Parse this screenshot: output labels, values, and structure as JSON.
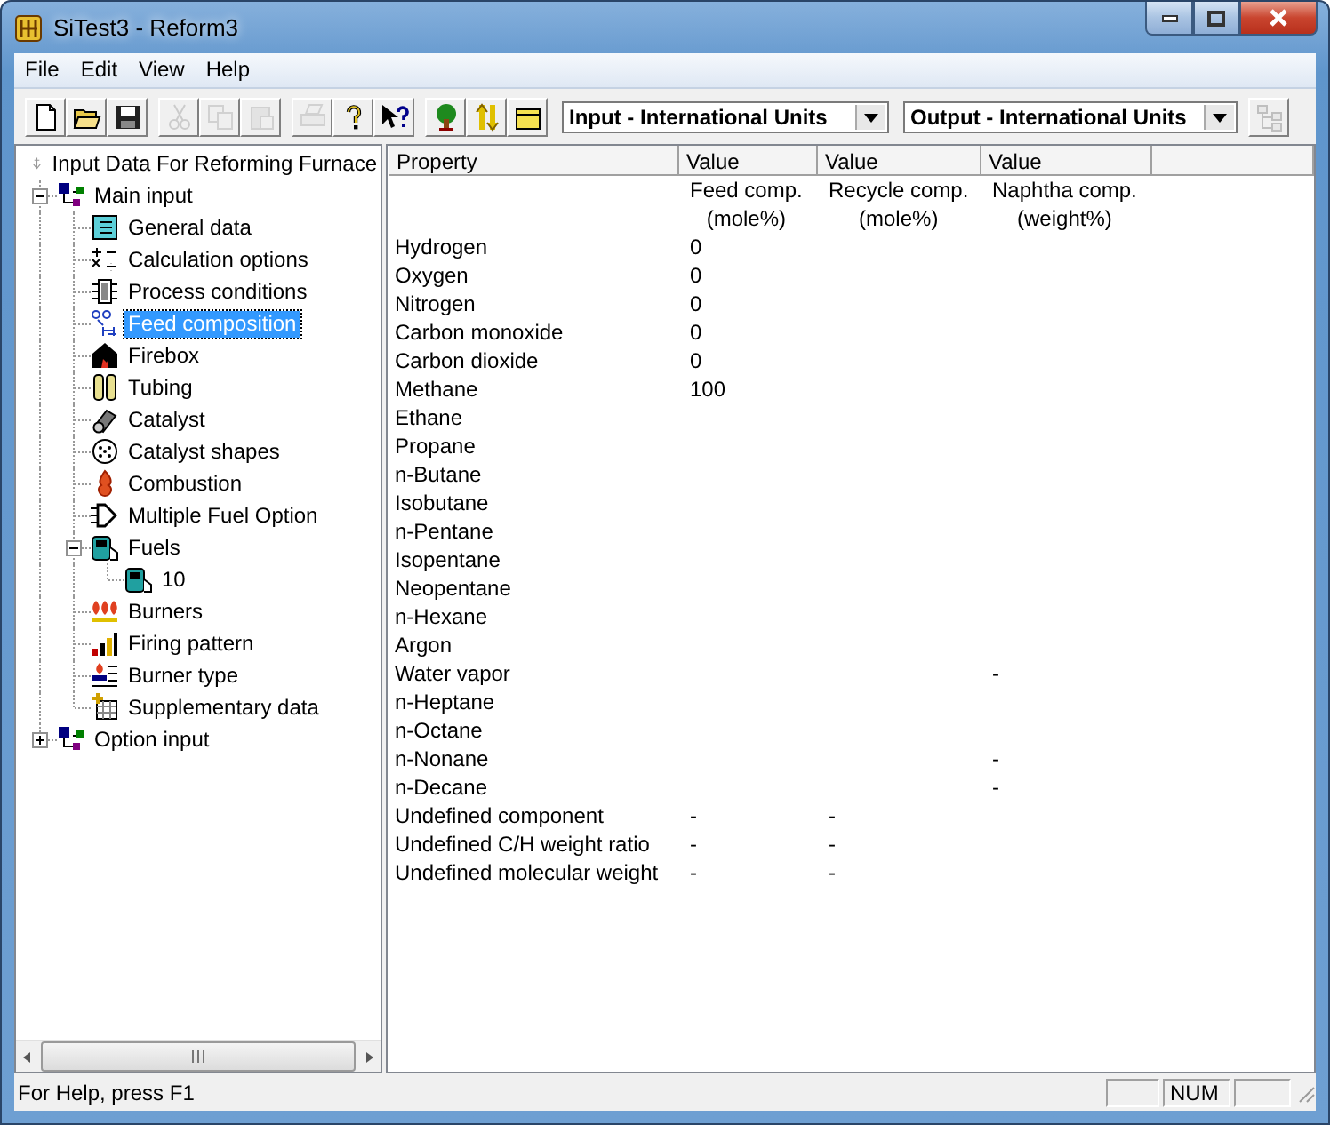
{
  "window": {
    "title": "SiTest3 - Reform3"
  },
  "menu": [
    "File",
    "Edit",
    "View",
    "Help"
  ],
  "toolbar": {
    "groups": [
      [
        {
          "kind": "new",
          "disabled": false
        },
        {
          "kind": "open",
          "disabled": false
        },
        {
          "kind": "save",
          "disabled": false
        }
      ],
      [
        {
          "kind": "cut",
          "disabled": true
        },
        {
          "kind": "copy",
          "disabled": true
        },
        {
          "kind": "paste",
          "disabled": true
        }
      ],
      [
        {
          "kind": "print",
          "disabled": true
        },
        {
          "kind": "help",
          "disabled": false
        },
        {
          "kind": "context_help",
          "disabled": false
        }
      ],
      [
        {
          "kind": "tree",
          "disabled": false
        },
        {
          "kind": "units",
          "disabled": false
        },
        {
          "kind": "folder",
          "disabled": false
        }
      ]
    ],
    "selectors": [
      "Input - International Units",
      "Output - International Units"
    ],
    "layout_button": {
      "disabled": true
    }
  },
  "tree": {
    "label": "Input Data For Reforming Furnace",
    "kind": "root",
    "selected": false,
    "children": [
      {
        "label": "Main input",
        "kind": "group",
        "expanded": true,
        "selected": false,
        "children": [
          {
            "label": "General data",
            "kind": "general",
            "selected": false
          },
          {
            "label": "Calculation options",
            "kind": "calc",
            "selected": false
          },
          {
            "label": "Process conditions",
            "kind": "process",
            "selected": false
          },
          {
            "label": "Feed composition",
            "kind": "feed",
            "selected": true
          },
          {
            "label": "Firebox",
            "kind": "firebox",
            "selected": false
          },
          {
            "label": "Tubing",
            "kind": "tubing",
            "selected": false
          },
          {
            "label": "Catalyst",
            "kind": "catalyst",
            "selected": false
          },
          {
            "label": "Catalyst shapes",
            "kind": "shapes",
            "selected": false
          },
          {
            "label": "Combustion",
            "kind": "combustion",
            "selected": false
          },
          {
            "label": "Multiple Fuel Option",
            "kind": "multi_fuel",
            "selected": false
          },
          {
            "label": "Fuels",
            "kind": "fuel",
            "expanded": true,
            "selected": false,
            "children": [
              {
                "label": "10",
                "kind": "fuel",
                "selected": false
              }
            ]
          },
          {
            "label": "Burners",
            "kind": "burners",
            "selected": false
          },
          {
            "label": "Firing pattern",
            "kind": "firing",
            "selected": false
          },
          {
            "label": "Burner type",
            "kind": "burner_type",
            "selected": false
          },
          {
            "label": "Supplementary data",
            "kind": "supplementary",
            "selected": false
          }
        ]
      },
      {
        "label": "Option input",
        "kind": "group",
        "expanded": false,
        "selected": false
      }
    ]
  },
  "table": {
    "columns": [
      {
        "label": "Property"
      },
      {
        "label": "Value",
        "subheading": "Feed comp.",
        "unit": "(mole%)"
      },
      {
        "label": "Value",
        "subheading": "Recycle comp.",
        "unit": "(mole%)"
      },
      {
        "label": "Value",
        "subheading": "Naphtha comp.",
        "unit": "(weight%)"
      }
    ],
    "rows": [
      {
        "property": "Hydrogen",
        "feed_comp": "0"
      },
      {
        "property": "Oxygen",
        "feed_comp": "0"
      },
      {
        "property": "Nitrogen",
        "feed_comp": "0"
      },
      {
        "property": "Carbon monoxide",
        "feed_comp": "0"
      },
      {
        "property": "Carbon dioxide",
        "feed_comp": "0"
      },
      {
        "property": "Methane",
        "feed_comp": "100"
      },
      {
        "property": "Ethane"
      },
      {
        "property": "Propane"
      },
      {
        "property": "n-Butane"
      },
      {
        "property": "Isobutane"
      },
      {
        "property": "n-Pentane"
      },
      {
        "property": "Isopentane"
      },
      {
        "property": "Neopentane"
      },
      {
        "property": "n-Hexane"
      },
      {
        "property": "Argon"
      },
      {
        "property": "Water vapor",
        "naphtha_comp": "-"
      },
      {
        "property": "n-Heptane"
      },
      {
        "property": "n-Octane"
      },
      {
        "property": "n-Nonane",
        "naphtha_comp": "-"
      },
      {
        "property": "n-Decane",
        "naphtha_comp": "-"
      },
      {
        "property": "Undefined component",
        "feed_comp": "-",
        "recycle_comp": "-"
      },
      {
        "property": "Undefined C/H weight ratio",
        "feed_comp": "-",
        "recycle_comp": "-"
      },
      {
        "property": "Undefined molecular weight",
        "feed_comp": "-",
        "recycle_comp": "-"
      }
    ]
  },
  "status_bar": {
    "message": "For Help, press F1",
    "indicators": [
      "NUM"
    ]
  }
}
